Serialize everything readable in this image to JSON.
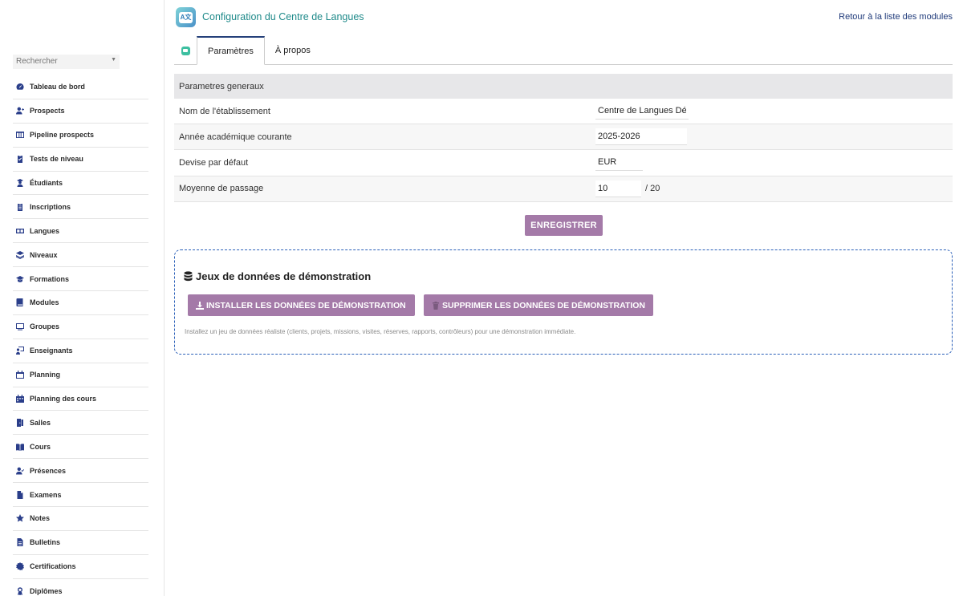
{
  "header": {
    "title": "Configuration du Centre de Langues",
    "back_link": "Retour à la liste des modules",
    "logo_text": "A文"
  },
  "sidebar": {
    "search_placeholder": "Rechercher",
    "items": [
      {
        "label": "Tableau de bord",
        "icon": "dashboard-icon"
      },
      {
        "label": "Prospects",
        "icon": "user-plus-icon"
      },
      {
        "label": "Pipeline prospects",
        "icon": "columns-icon"
      },
      {
        "label": "Tests de niveau",
        "icon": "clipboard-check-icon"
      },
      {
        "label": "Étudiants",
        "icon": "student-icon"
      },
      {
        "label": "Inscriptions",
        "icon": "clipboard-icon"
      },
      {
        "label": "Langues",
        "icon": "language-icon"
      },
      {
        "label": "Niveaux",
        "icon": "layers-icon"
      },
      {
        "label": "Formations",
        "icon": "graduation-cap-icon"
      },
      {
        "label": "Modules",
        "icon": "book-icon"
      },
      {
        "label": "Groupes",
        "icon": "screen-icon"
      },
      {
        "label": "Enseignants",
        "icon": "teacher-icon"
      },
      {
        "label": "Planning",
        "icon": "calendar-icon"
      },
      {
        "label": "Planning des cours",
        "icon": "calendar-days-icon"
      },
      {
        "label": "Salles",
        "icon": "door-icon"
      },
      {
        "label": "Cours",
        "icon": "open-book-icon"
      },
      {
        "label": "Présences",
        "icon": "user-check-icon"
      },
      {
        "label": "Examens",
        "icon": "file-icon"
      },
      {
        "label": "Notes",
        "icon": "star-icon"
      },
      {
        "label": "Bulletins",
        "icon": "file-lines-icon"
      },
      {
        "label": "Certifications",
        "icon": "badge-icon"
      },
      {
        "label": "Diplômes",
        "icon": "award-icon"
      }
    ]
  },
  "tabs": [
    {
      "label": "Paramètres",
      "active": true
    },
    {
      "label": "À propos",
      "active": false
    }
  ],
  "settings": {
    "section_title": "Parametres generaux",
    "rows": [
      {
        "label": "Nom de l'établissement",
        "value": "Centre de Langues Dém",
        "suffix": ""
      },
      {
        "label": "Année académique courante",
        "value": "2025-2026",
        "suffix": ""
      },
      {
        "label": "Devise par défaut",
        "value": "EUR",
        "suffix": ""
      },
      {
        "label": "Moyenne de passage",
        "value": "10",
        "suffix": "/ 20"
      }
    ],
    "save_label": "ENREGISTRER"
  },
  "demo": {
    "title": "Jeux de données de démonstration",
    "install_label": "INSTALLER LES DONNÉES DE DÉMONSTRATION",
    "remove_label": "SUPPRIMER LES DONNÉES DE DÉMONSTRATION",
    "hint": "Installez un jeu de données réaliste (clients, projets, missions, visites, réserves, rapports, contrôleurs) pour une démonstration immédiate."
  },
  "colors": {
    "accent": "#a47aa8",
    "title": "#1f8a8a",
    "link": "#1f3a7a",
    "icon": "#2a3e8a",
    "demo_border": "#2a5fb8"
  }
}
